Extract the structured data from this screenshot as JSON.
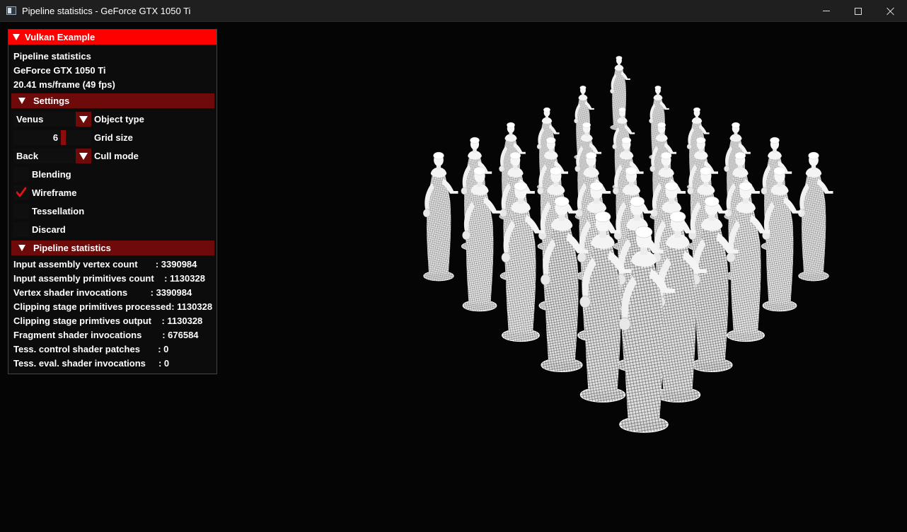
{
  "window": {
    "title": "Pipeline statistics - GeForce GTX 1050 Ti"
  },
  "panel": {
    "title": "Vulkan Example",
    "info": {
      "example_name": "Pipeline statistics",
      "device": "GeForce GTX 1050 Ti",
      "frame_time": "20.41 ms/frame (49 fps)"
    },
    "settings": {
      "header": "Settings",
      "object_type": {
        "value": "Venus",
        "label": "Object type"
      },
      "grid_size": {
        "value": "6",
        "label": "Grid size",
        "fraction": 0.6
      },
      "cull_mode": {
        "value": "Back",
        "label": "Cull mode"
      },
      "blending": {
        "label": "Blending",
        "checked": false
      },
      "wireframe": {
        "label": "Wireframe",
        "checked": true
      },
      "tessellation": {
        "label": "Tessellation",
        "checked": false
      },
      "discard": {
        "label": "Discard",
        "checked": false
      }
    },
    "stats": {
      "header": "Pipeline statistics",
      "rows": [
        "Input assembly vertex count       : 3390984",
        "Input assembly primitives count    : 1130328",
        "Vertex shader invocations         : 3390984",
        "Clipping stage primitives processed: 1130328",
        "Clipping stage primtives output    : 1130328",
        "Fragment shader invocations        : 676584",
        "Tess. control shader patches       : 0",
        "Tess. eval. shader invocations     : 0"
      ]
    }
  },
  "colors": {
    "header_red": "#ff0000",
    "section_red": "#6e0a0a",
    "check_red": "#e01414"
  }
}
